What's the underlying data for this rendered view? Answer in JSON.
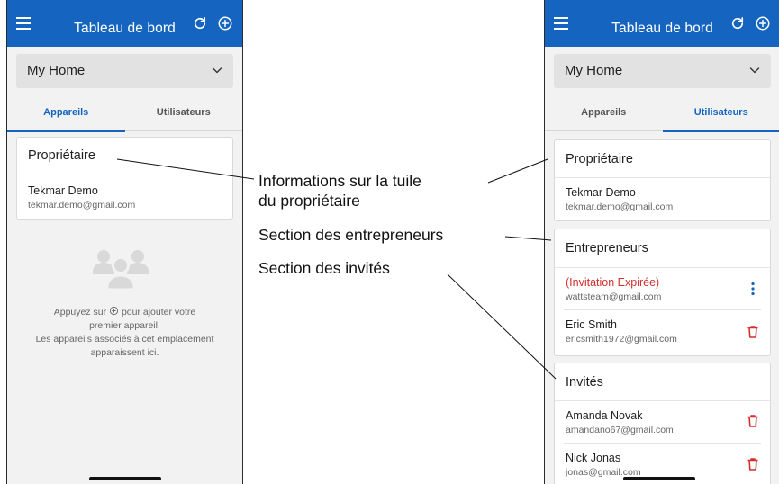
{
  "left_screen": {
    "app_bar": {
      "title": "Tableau de bord"
    },
    "location_select": {
      "value": "My Home"
    },
    "tabs": [
      {
        "label": "Appareils",
        "active": true
      },
      {
        "label": "Utilisateurs",
        "active": false
      }
    ],
    "owner_card": {
      "title": "Propriétaire",
      "name": "Tekmar Demo",
      "email": "tekmar.demo@gmail.com"
    },
    "empty_state": {
      "line1_before_icon": "Appuyez sur",
      "line1_after_icon": "pour ajouter votre",
      "line2": "premier appareil.",
      "line3": "Les appareils associés à cet emplacement",
      "line4": "apparaissent ici."
    }
  },
  "right_screen": {
    "app_bar": {
      "title": "Tableau de bord"
    },
    "location_select": {
      "value": "My Home"
    },
    "tabs": [
      {
        "label": "Appareils",
        "active": false
      },
      {
        "label": "Utilisateurs",
        "active": true
      }
    ],
    "owner_card": {
      "title": "Propriétaire",
      "name": "Tekmar Demo",
      "email": "tekmar.demo@gmail.com"
    },
    "contractors_card": {
      "title": "Entrepreneurs",
      "items": [
        {
          "name": "(Invitation Expirée)",
          "email": "wattsteam@gmail.com",
          "action_icon": "more-vert-icon"
        },
        {
          "name": "Eric Smith",
          "email": "ericsmith1972@gmail.com",
          "action_icon": "trash-icon"
        }
      ]
    },
    "guests_card": {
      "title": "Invités",
      "items": [
        {
          "name": "Amanda Novak",
          "email": "amandano67@gmail.com",
          "action_icon": "trash-icon"
        },
        {
          "name": "Nick Jonas",
          "email": "jonas@gmail.com",
          "action_icon": "trash-icon"
        }
      ]
    }
  },
  "annotations": {
    "owner_tile_line1": "Informations sur la tuile",
    "owner_tile_line2": "du propriétaire",
    "contractors_section": "Section des entrepreneurs",
    "guests_section": "Section des invités"
  },
  "colors": {
    "primary": "#1565c0",
    "background": "#f2f2f2",
    "danger": "#d32f2f"
  }
}
